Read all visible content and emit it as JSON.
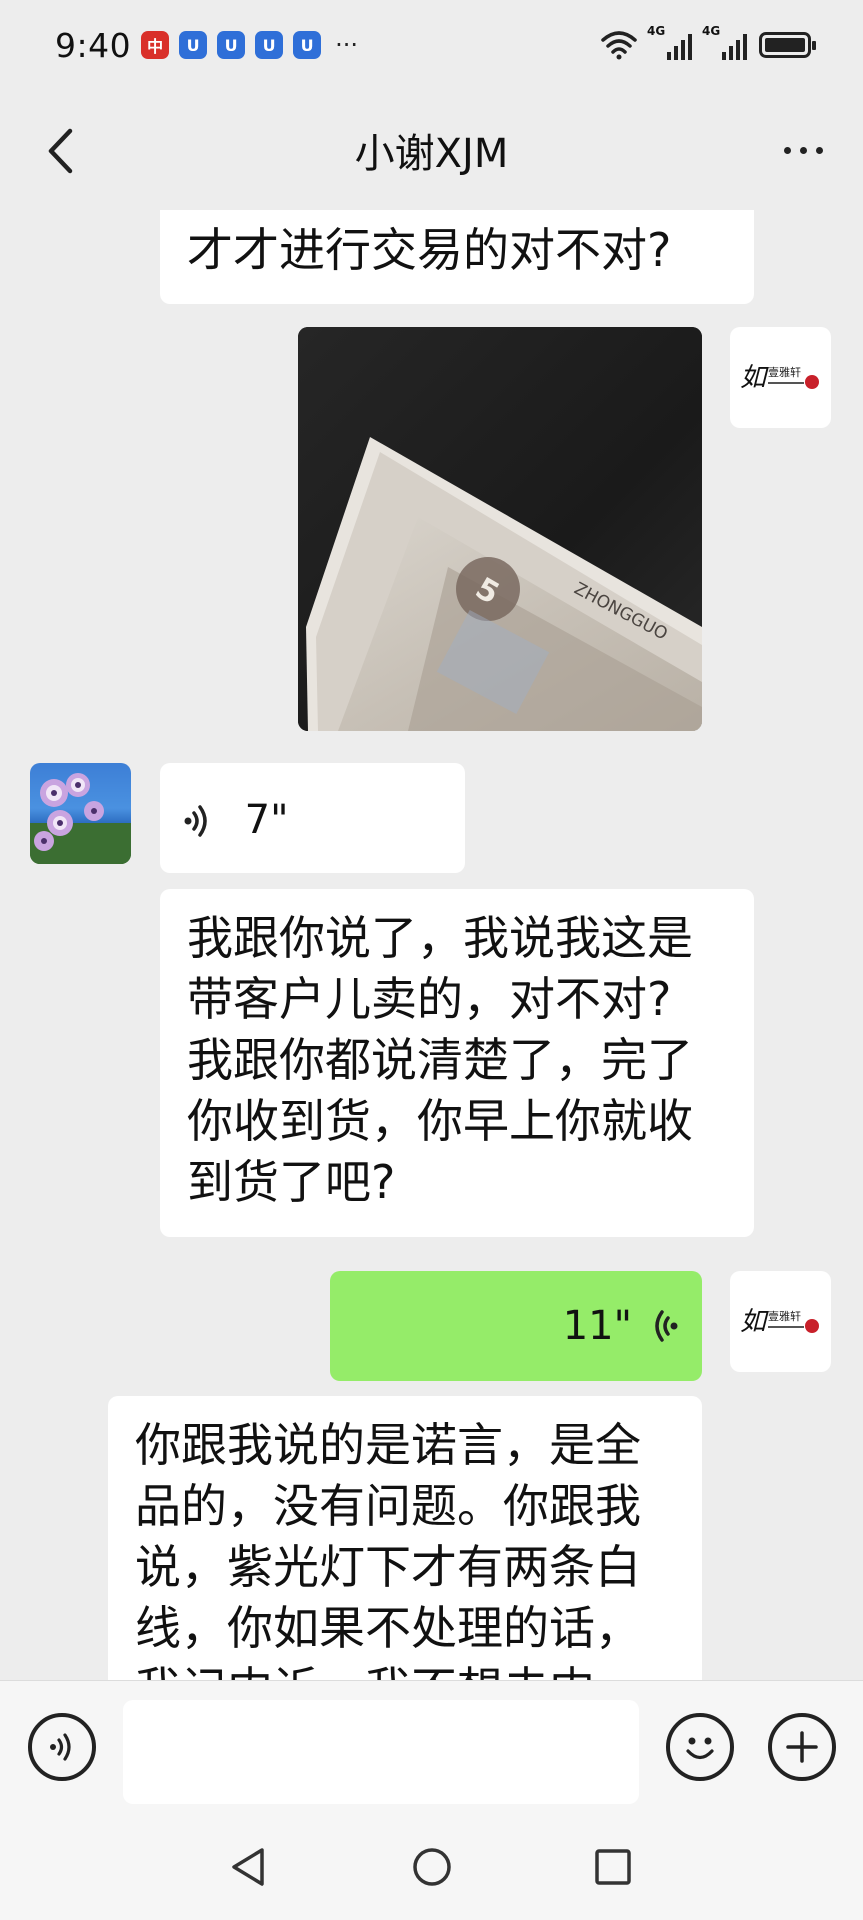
{
  "status_bar": {
    "time": "9:40",
    "app_icons": [
      "app-badge-red",
      "app-badge-blue",
      "app-badge-blue",
      "app-badge-blue",
      "app-badge-blue"
    ],
    "more": "···",
    "network_1": "4G",
    "network_2": "4G"
  },
  "header": {
    "title": "小谢XJM"
  },
  "messages": [
    {
      "id": "m1",
      "side": "left",
      "type": "text",
      "text": "才才进行交易的对不对?"
    },
    {
      "id": "m2",
      "side": "right",
      "type": "image",
      "image_text": "ZHONGGUO",
      "image_denomination": "5"
    },
    {
      "id": "m3",
      "side": "left",
      "type": "voice",
      "duration": "7\""
    },
    {
      "id": "m4",
      "side": "left",
      "type": "text",
      "lines": [
        "我跟你说了，我说我这是",
        "带客户儿卖的，对不对?",
        "我跟你都说清楚了，完了",
        "你收到货，你早上你就收",
        "到货了吧?"
      ]
    },
    {
      "id": "m5",
      "side": "right",
      "type": "voice",
      "duration": "11\""
    },
    {
      "id": "m6",
      "side": "left",
      "type": "text",
      "lines": [
        "你跟我说的是诺言，是全",
        "品的，没有问题。你跟我",
        "说，紫光灯下才有两条白",
        "线，你如果不处理的话，",
        "我记内诉，我不想去内"
      ]
    }
  ],
  "colors": {
    "background": "#ededed",
    "bubble_in": "#ffffff",
    "bubble_out": "#95ec69",
    "logo_red": "#c8202a"
  },
  "input_bar": {
    "placeholder": "",
    "voice_icon": "voice-input-icon",
    "emoji_icon": "emoji-icon",
    "add_icon": "add-icon"
  },
  "nav_bar": {
    "back": "nav-back-icon",
    "home": "nav-home-icon",
    "recent": "nav-recent-icon"
  }
}
